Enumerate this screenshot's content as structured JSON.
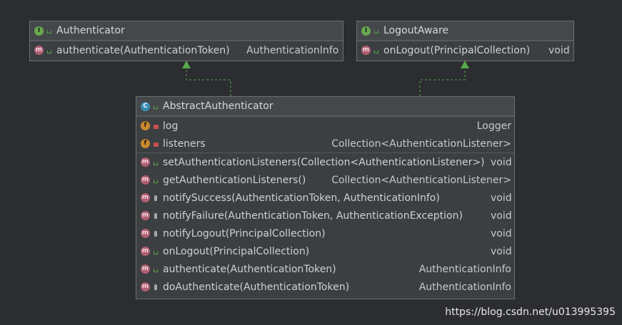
{
  "authenticator": {
    "name": "Authenticator",
    "methods": [
      {
        "name": "authenticate(AuthenticationToken)",
        "type": "AuthenticationInfo"
      }
    ]
  },
  "logout_aware": {
    "name": "LogoutAware",
    "methods": [
      {
        "name": "onLogout(PrincipalCollection)",
        "type": "void"
      }
    ]
  },
  "abstract_authenticator": {
    "name": "AbstractAuthenticator",
    "fields": [
      {
        "name": "log",
        "type": "Logger"
      },
      {
        "name": "listeners",
        "type": "Collection<AuthenticationListener>"
      }
    ],
    "methods": [
      {
        "name": "setAuthenticationListeners(Collection<AuthenticationListener>)",
        "type": "void"
      },
      {
        "name": "getAuthenticationListeners()",
        "type": "Collection<AuthenticationListener>"
      },
      {
        "name": "notifySuccess(AuthenticationToken, AuthenticationInfo)",
        "type": "void"
      },
      {
        "name": "notifyFailure(AuthenticationToken, AuthenticationException)",
        "type": "void"
      },
      {
        "name": "notifyLogout(PrincipalCollection)",
        "type": "void"
      },
      {
        "name": "onLogout(PrincipalCollection)",
        "type": "void"
      },
      {
        "name": "authenticate(AuthenticationToken)",
        "type": "AuthenticationInfo"
      },
      {
        "name": "doAuthenticate(AuthenticationToken)",
        "type": "AuthenticationInfo"
      }
    ]
  },
  "badges": {
    "interface": "I",
    "class": "C",
    "method": "m",
    "field": "f"
  },
  "watermark": "https://blog.csdn.net/u013995395"
}
